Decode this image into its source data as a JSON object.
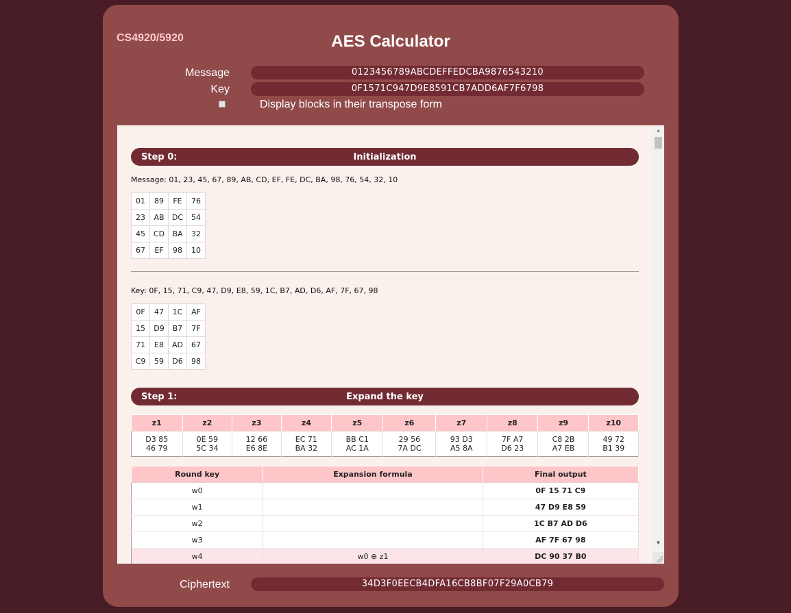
{
  "course": "CS4920/5920",
  "title": "AES Calculator",
  "inputs": {
    "message_label": "Message",
    "message_value": "0123456789ABCDEFFEDCBA9876543210",
    "key_label": "Key",
    "key_value": "0F1571C947D9E8591CB7ADD6AF7F6798",
    "transpose_label": "Display blocks in their transpose form"
  },
  "step0": {
    "num": "Step 0:",
    "name": "Initialization",
    "message_line": "Message: 01, 23, 45, 67, 89, AB, CD, EF, FE, DC, BA, 98, 76, 54, 32, 10",
    "message_matrix": [
      [
        "01",
        "89",
        "FE",
        "76"
      ],
      [
        "23",
        "AB",
        "DC",
        "54"
      ],
      [
        "45",
        "CD",
        "BA",
        "32"
      ],
      [
        "67",
        "EF",
        "98",
        "10"
      ]
    ],
    "key_line": "Key: 0F, 15, 71, C9, 47, D9, E8, 59, 1C, B7, AD, D6, AF, 7F, 67, 98",
    "key_matrix": [
      [
        "0F",
        "47",
        "1C",
        "AF"
      ],
      [
        "15",
        "D9",
        "B7",
        "7F"
      ],
      [
        "71",
        "E8",
        "AD",
        "67"
      ],
      [
        "C9",
        "59",
        "D6",
        "98"
      ]
    ]
  },
  "step1": {
    "num": "Step 1:",
    "name": "Expand the key",
    "z_headers": [
      "z1",
      "z2",
      "z3",
      "z4",
      "z5",
      "z6",
      "z7",
      "z8",
      "z9",
      "z10"
    ],
    "z_line1": [
      "D3 85",
      "0E 59",
      "12 66",
      "EC 71",
      "BB C1",
      "29 56",
      "93 D3",
      "7F A7",
      "C8 2B",
      "49 72"
    ],
    "z_line2": [
      "46 79",
      "5C 34",
      "E6 8E",
      "BA 32",
      "AC 1A",
      "7A DC",
      "A5 8A",
      "D6 23",
      "A7 EB",
      "B1 39"
    ],
    "w_headers": [
      "Round key",
      "Expansion formula",
      "Final output"
    ],
    "w_rows": [
      {
        "key": "w0",
        "formula": "",
        "output": "0F 15 71 C9"
      },
      {
        "key": "w1",
        "formula": "",
        "output": "47 D9 E8 59"
      },
      {
        "key": "w2",
        "formula": "",
        "output": "1C B7 AD D6"
      },
      {
        "key": "w3",
        "formula": "",
        "output": "AF 7F 67 98"
      },
      {
        "key": "w4",
        "formula": "w0 ⊕ z1",
        "output": "DC 90 37 B0"
      }
    ]
  },
  "output": {
    "ciphertext_label": "Ciphertext",
    "ciphertext_value": "34D3F0EECB4DFA16CB8BF07F29A0CB79"
  },
  "colors": {
    "background": "#481c24",
    "panel": "#914a4a",
    "bar": "#722b32",
    "table_header": "#ffc6ca"
  }
}
